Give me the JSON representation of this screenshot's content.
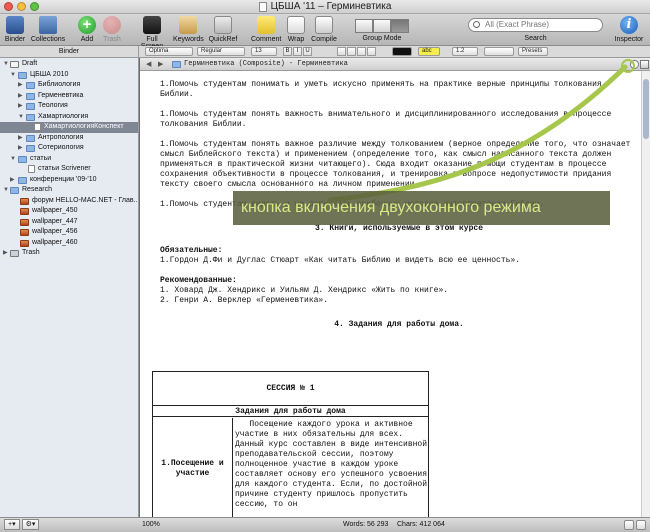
{
  "window": {
    "title": "ЦБША '11 – Герминевтика"
  },
  "toolbar": {
    "binder": "Binder",
    "collections": "Collections",
    "add": "Add",
    "trash": "Trash",
    "fullscreen": "Full Screen",
    "keywords": "Keywords",
    "quickref": "QuickRef",
    "comment": "Comment",
    "wrap": "Wrap",
    "compile": "Compile",
    "group_mode": "Group Mode",
    "search_label": "Search",
    "search_placeholder": "All (Exact Phrase)",
    "inspector": "Inspector",
    "inspector_glyph": "i"
  },
  "formatbar": {
    "binder_header": "Binder",
    "font": "Optima",
    "style": "Regular",
    "size": "13",
    "bold": "B",
    "italic": "I",
    "underline": "U",
    "highlight": "abc",
    "spacing": "1.2",
    "lists": "Presets"
  },
  "binder": {
    "items": [
      {
        "label": "Draft",
        "icon": "draft"
      },
      {
        "label": "ЦБША 2010",
        "icon": "folder"
      },
      {
        "label": "Библиология",
        "icon": "folder"
      },
      {
        "label": "Герменевтика",
        "icon": "folder"
      },
      {
        "label": "Теология",
        "icon": "folder"
      },
      {
        "label": "Хамартиология",
        "icon": "folder"
      },
      {
        "label": "ХамартиологияКонспект",
        "icon": "doc"
      },
      {
        "label": "Антропология",
        "icon": "folder"
      },
      {
        "label": "Сотериология",
        "icon": "folder"
      },
      {
        "label": "статьи",
        "icon": "folder"
      },
      {
        "label": "статьи Scrivener",
        "icon": "doc"
      },
      {
        "label": "конференции '09-'10",
        "icon": "folder"
      },
      {
        "label": "Research",
        "icon": "folder"
      },
      {
        "label": "форум HELLO-MAC.NET - Глав...",
        "icon": "image"
      },
      {
        "label": "wallpaper_450",
        "icon": "image"
      },
      {
        "label": "wallpaper_447",
        "icon": "image"
      },
      {
        "label": "wallpaper_456",
        "icon": "image"
      },
      {
        "label": "wallpaper_460",
        "icon": "image"
      },
      {
        "label": "Trash",
        "icon": "trash"
      }
    ]
  },
  "editor": {
    "path": "Герминевтика (Composite) - Герминевтика",
    "paragraphs": [
      "1.Помочь студентам понимать и уметь искусно применять на практике верные принципы толкования Библии.",
      "1.Помочь студентам понять важность внимательного и дисциплинированного исследования в процессе толкования Библии.",
      "1.Помочь студентам понять важное различие между толкованием (верное определение того, что означает смысл Библейского текста) и применением (определение того, как смысл написанного текста должен применяться в практической жизни читающего). Сюда входит оказание помощи студентам в процессе сохранения объективности в процессе толкования, и тренировка в вопросе недопустимости придания тексту своего смысла основанного на личном применении.",
      "1.Помочь студентам видеть и не допускать ошибочных методов интерпретации Библии."
    ],
    "heading3": "3. Книги, используемые в этом курсе",
    "required_label": "Обязательные:",
    "required_1": "1.Гордон Д.Фи и Дуглас Стюарт «Как читать Библию и видеть всю ее ценность».",
    "recommended_label": "Рекомендованные:",
    "recommended_1": "1. Ховард Дж. Хендрикс и Уильям Д. Хендрикс «Жить по книге».",
    "recommended_2": "2. Генри А. Верклер «Герменевтика».",
    "heading4": "4. Задания для работы дома.",
    "table": {
      "session": "СЕССИЯ № 1",
      "subtitle": "Задания для работы дома",
      "left": "1.Посещение и участие",
      "right": "   Посещение каждого урока и активное участие в них обязательны для всех. Данный курс составлен в виде интенсивной преподавательской сессии, поэтому полноценное участие в каждом уроке составляет основу его успешного усвоения для каждого студента. Если, по достойной причине студенту пришлось пропустить сессию, то он"
    }
  },
  "callout": {
    "text": "кнопка включения двухоконного режима",
    "color": "#d7ea86"
  },
  "statusbar": {
    "zoom": "100%",
    "words": "Words: 56 293",
    "chars": "Chars: 412 064",
    "add": "+▾",
    "gear": "⚙▾"
  }
}
